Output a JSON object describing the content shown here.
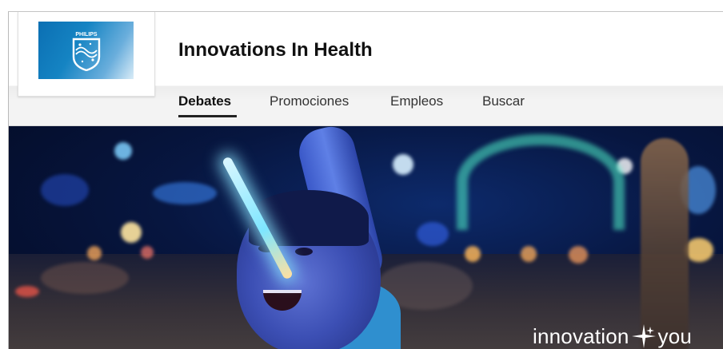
{
  "company": {
    "name": "Innovations In Health",
    "logo_text": "PHILIPS",
    "logo_icon": "philips-shield-icon",
    "brand_color": "#0b6fb3"
  },
  "tabs": [
    {
      "label": "Debates",
      "active": true
    },
    {
      "label": "Promociones",
      "active": false
    },
    {
      "label": "Empleos",
      "active": false
    },
    {
      "label": "Buscar",
      "active": false
    }
  ],
  "banner": {
    "tagline_left": "innovation",
    "tagline_icon": "sparkle-plus-icon",
    "tagline_right": "you"
  }
}
